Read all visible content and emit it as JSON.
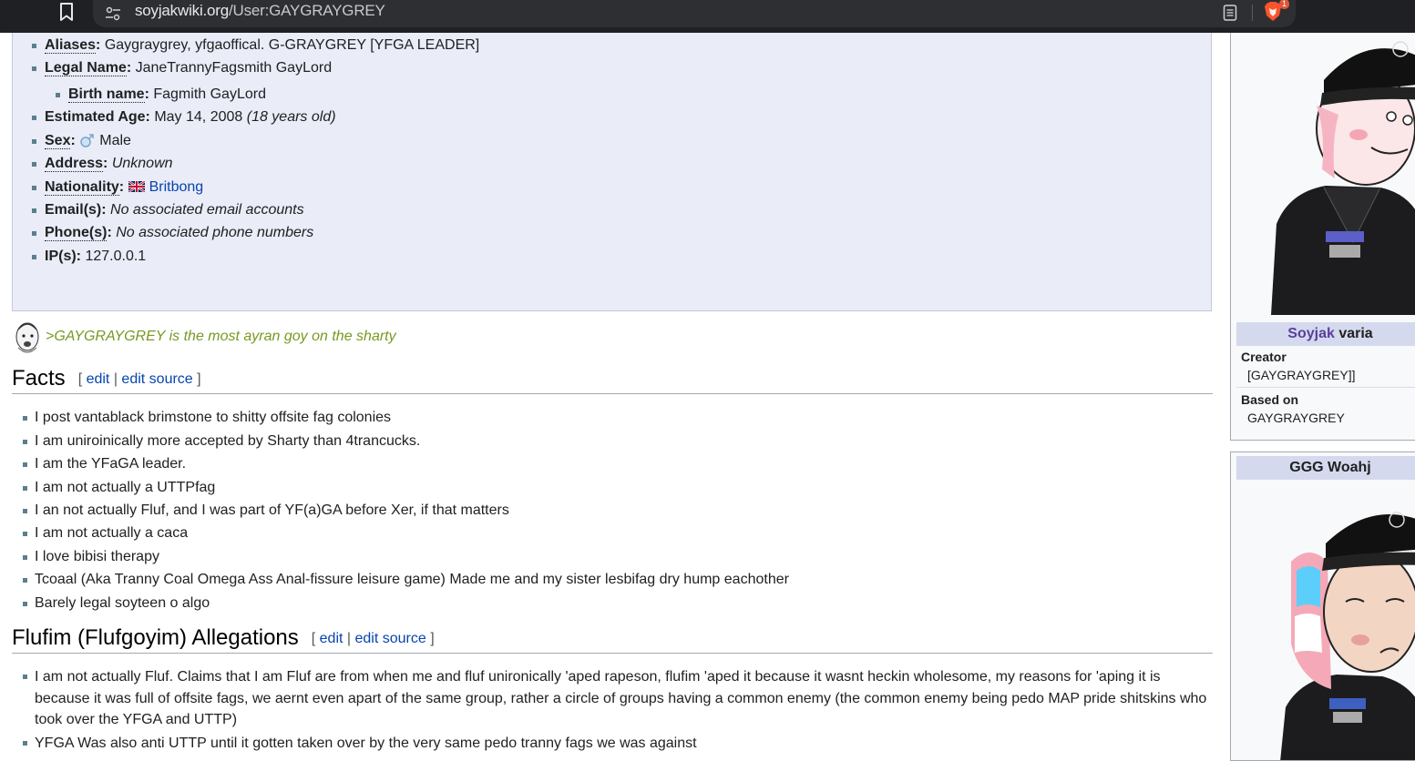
{
  "browser": {
    "url_host": "soyjakwiki.org",
    "url_path": "/User:GAYGRAYGREY",
    "shields_count": "1",
    "icons": [
      "bookmark-icon",
      "site-settings-icon",
      "reader-mode-icon",
      "brave-shields-icon"
    ]
  },
  "infobox": {
    "aliases_label": "Aliases",
    "aliases_value": "Gaygraygrey, yfgaoffical. G-GRAYGREY [YFGA LEADER]",
    "legal_name_label": "Legal Name",
    "legal_name_value": "JaneTrannyFagsmith GayLord",
    "birth_name_label": "Birth name",
    "birth_name_value": "Fagmith GayLord",
    "age_label": "Estimated Age",
    "age_value": "May 14, 2008",
    "age_note": "(18 years old)",
    "sex_label": "Sex",
    "sex_value": "Male",
    "address_label": "Address",
    "address_value": "Unknown",
    "nationality_label": "Nationality",
    "nationality_value": "Britbong",
    "emails_label": "Email(s)",
    "emails_value": "No associated email accounts",
    "phones_label": "Phone(s)",
    "phones_value": "No associated phone numbers",
    "ips_label": "IP(s)",
    "ips_value": "127.0.0.1"
  },
  "greentext": ">GAYGRAYGREY is the most ayran goy on the sharty",
  "facts_section": {
    "title": "Facts",
    "edit": "edit",
    "edit_source": "edit source",
    "items": [
      "I post vantablack brimstone to shitty offsite fag colonies",
      "I am uniroinically more accepted by Sharty than 4trancucks.",
      "I am the YFaGA leader.",
      "I am not actually a UTTPfag",
      "I an not actually Fluf, and I was part of YF(a)GA before Xer, if that matters",
      "I am not actually a caca",
      "I love bibisi therapy",
      "Tcoaal (Aka Tranny Coal Omega Ass Anal-fissure leisure game) Made me and my sister lesbifag dry hump eachother",
      "Barely legal soyteen o algo"
    ]
  },
  "allegations_section": {
    "title": "Flufim (Flufgoyim) Allegations",
    "edit": "edit",
    "edit_source": "edit source",
    "items": [
      "I am not actually Fluf. Claims that I am Fluf are from when me and fluf unironically 'aped rapeson, flufim 'aped it because it wasnt heckin wholesome, my reasons for 'aping it is because it was full of offsite fags, we aernt even apart of the same group, rather a circle of groups having a common enemy (the common enemy being pedo MAP pride shitskins who took over the YFGA and UTTP)",
      "YFGA Was also anti UTTP until it gotten taken over by the very same pedo tranny fags we was against"
    ]
  },
  "sidebar": {
    "variant_title_prefix": "Soyjak",
    "variant_title_suffix": "varia",
    "creator_label": "Creator",
    "creator_value": "[GAYGRAYGREY]]",
    "based_on_label": "Based on",
    "based_on_value": "GAYGRAYGREY",
    "second_title": "GGG Woahj"
  },
  "colors": {
    "infobox_bg": "#eaecf8",
    "link": "#0645ad",
    "greentext": "#789922",
    "sidebar_title_bg": "#d4d9ee"
  }
}
